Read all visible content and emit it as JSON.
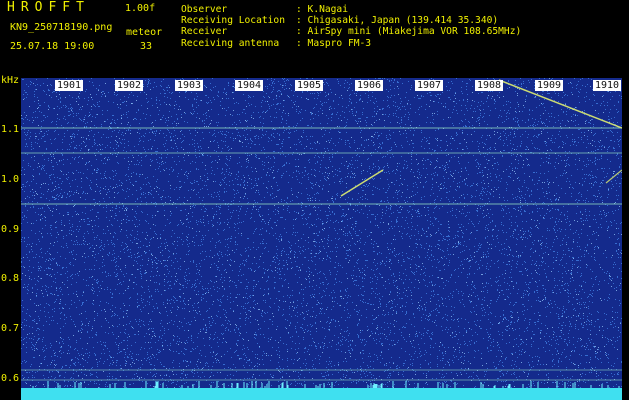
{
  "header": {
    "app_title": "HROFFT",
    "version": "1.00f",
    "filename": "KN9_250718190.png",
    "mode": "meteor",
    "datetime": "25.07.18 19:00",
    "count": "33"
  },
  "info": [
    {
      "label": "Observer",
      "value": ": K.Nagai"
    },
    {
      "label": "Receiving Location",
      "value": ": Chigasaki, Japan (139.414 35.340)"
    },
    {
      "label": "Receiver",
      "value": ": AirSpy mini (Miakejima VOR 108.65MHz)"
    },
    {
      "label": "Receiving antenna",
      "value": ": Maspro FM-3"
    }
  ],
  "spectrogram": {
    "unit": "kHz",
    "y_ticks": [
      "1.1",
      "1.0",
      "0.9",
      "0.8",
      "0.7",
      "0.6"
    ],
    "x_ticks": [
      "1901",
      "1902",
      "1903",
      "1904",
      "1905",
      "1906",
      "1907",
      "1908",
      "1909",
      "1910"
    ],
    "colors": {
      "background": "#142a8c",
      "noise": "#3c78dc",
      "signal": "#a0f0c8",
      "meteor": "#e0f070",
      "label": "#f0f000"
    }
  }
}
